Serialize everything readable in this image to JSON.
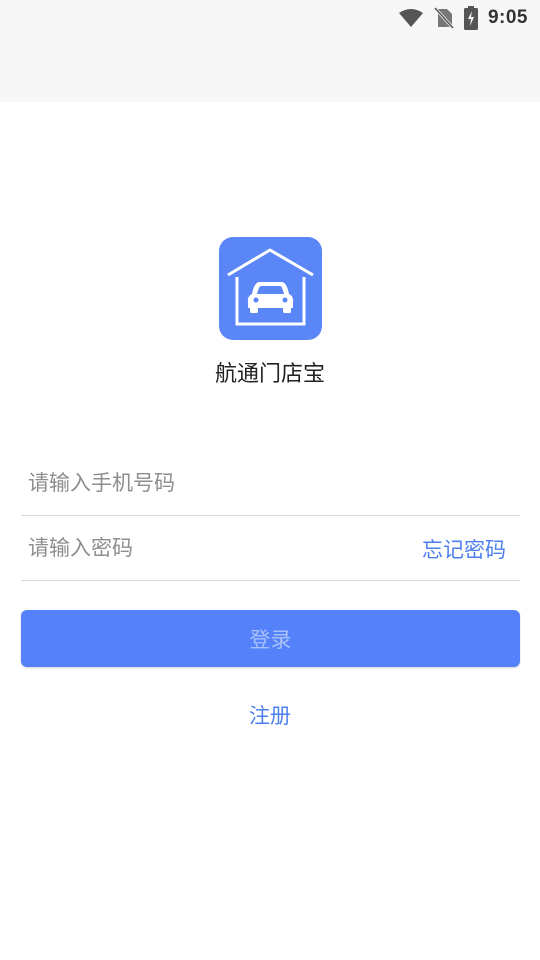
{
  "status_bar": {
    "time": "9:05",
    "icons": [
      "wifi-icon",
      "no-sim-icon",
      "battery-charging-icon"
    ]
  },
  "app": {
    "name": "航通门店宝",
    "logo_icon": "garage-car-icon",
    "accent_color": "#5582fb"
  },
  "form": {
    "phone_placeholder": "请输入手机号码",
    "phone_value": "",
    "password_placeholder": "请输入密码",
    "password_value": "",
    "forgot_password_label": "忘记密码",
    "login_label": "登录",
    "register_label": "注册"
  }
}
